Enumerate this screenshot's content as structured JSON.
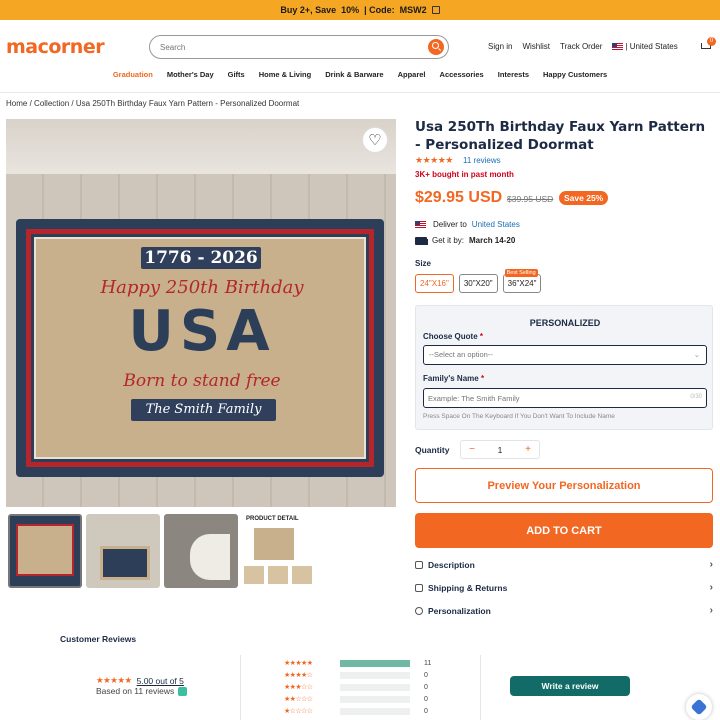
{
  "promo": {
    "text": "Buy 2+, Save ",
    "highlight": "10%",
    "code_text": " | Code: ",
    "code": "MSW2"
  },
  "header": {
    "logo": "macorner",
    "search_placeholder": "Search",
    "links": {
      "signin": "Sign in",
      "wishlist": "Wishlist",
      "track": "Track Order",
      "country": "| United States"
    },
    "cart_count": "0"
  },
  "nav": [
    "Graduation",
    "Mother's Day",
    "Gifts",
    "Home & Living",
    "Drink & Barware",
    "Apparel",
    "Accessories",
    "Interests",
    "Happy Customers"
  ],
  "breadcrumb": {
    "home": "Home",
    "collection": "Collection",
    "current": "Usa 250Th Birthday Faux Yarn Pattern - Personalized Doormat",
    "sep": "/"
  },
  "hero": {
    "years": "1776 - 2026",
    "birthday": "Happy 250th Birthday",
    "usa": "USA",
    "motto": "Born to stand free",
    "family": "The Smith Family"
  },
  "thumbs": {
    "detail_title": "PRODUCT DETAIL"
  },
  "product": {
    "title": "Usa 250Th Birthday Faux Yarn Pattern - Personalized Doormat",
    "stars": "★★★★★",
    "reviews": "11 reviews",
    "sold": "3K+ bought in past month",
    "price": "$29.95 USD",
    "old_price": "$39.95 USD",
    "save": "Save 25%",
    "deliver_label": "Deliver to",
    "deliver_country": "United States",
    "getby_label": "Get it by:",
    "getby_date": "March 14-20",
    "size_label": "Size",
    "sizes": [
      {
        "label": "24\"X16\"",
        "selected": true
      },
      {
        "label": "30\"X20\"",
        "selected": false
      },
      {
        "label": "36\"X24\"",
        "selected": false,
        "tag": "Best Selling"
      }
    ]
  },
  "personalized": {
    "title": "PERSONALIZED",
    "quote_label": "Choose Quote",
    "quote_placeholder": "--Select an option--",
    "name_label": "Family's Name",
    "name_placeholder": "Example: The Smith Family",
    "name_counter": "0/30",
    "hint": "Press Space On The Keyboard If You Don't Want To Include Name",
    "required_mark": "*"
  },
  "quantity": {
    "label": "Quantity",
    "value": "1",
    "minus": "−",
    "plus": "+"
  },
  "buttons": {
    "preview": "Preview Your Personalization",
    "add_to_cart": "ADD TO CART"
  },
  "accordion": [
    "Description",
    "Shipping & Returns",
    "Personalization"
  ],
  "reviews": {
    "title": "Customer Reviews",
    "stars": "★★★★★",
    "score": "5.00 out of 5",
    "based": "Based on 11 reviews",
    "write": "Write a review",
    "distribution": [
      {
        "stars": "★★★★★",
        "count": "11",
        "fraction": 1.0
      },
      {
        "stars": "★★★★☆",
        "count": "0",
        "fraction": 0
      },
      {
        "stars": "★★★☆☆",
        "count": "0",
        "fraction": 0
      },
      {
        "stars": "★★☆☆☆",
        "count": "0",
        "fraction": 0
      },
      {
        "stars": "★☆☆☆☆",
        "count": "0",
        "fraction": 0
      }
    ]
  },
  "colors": {
    "accent": "#f26722",
    "navy": "#1c2a44",
    "promo_bg": "#f5a623",
    "review_green": "#126b66"
  },
  "icons": {
    "heart": "heart-icon",
    "cart": "cart-icon",
    "search": "search-icon",
    "truck": "truck-icon",
    "flag": "us-flag-icon",
    "copy": "copy-icon"
  }
}
